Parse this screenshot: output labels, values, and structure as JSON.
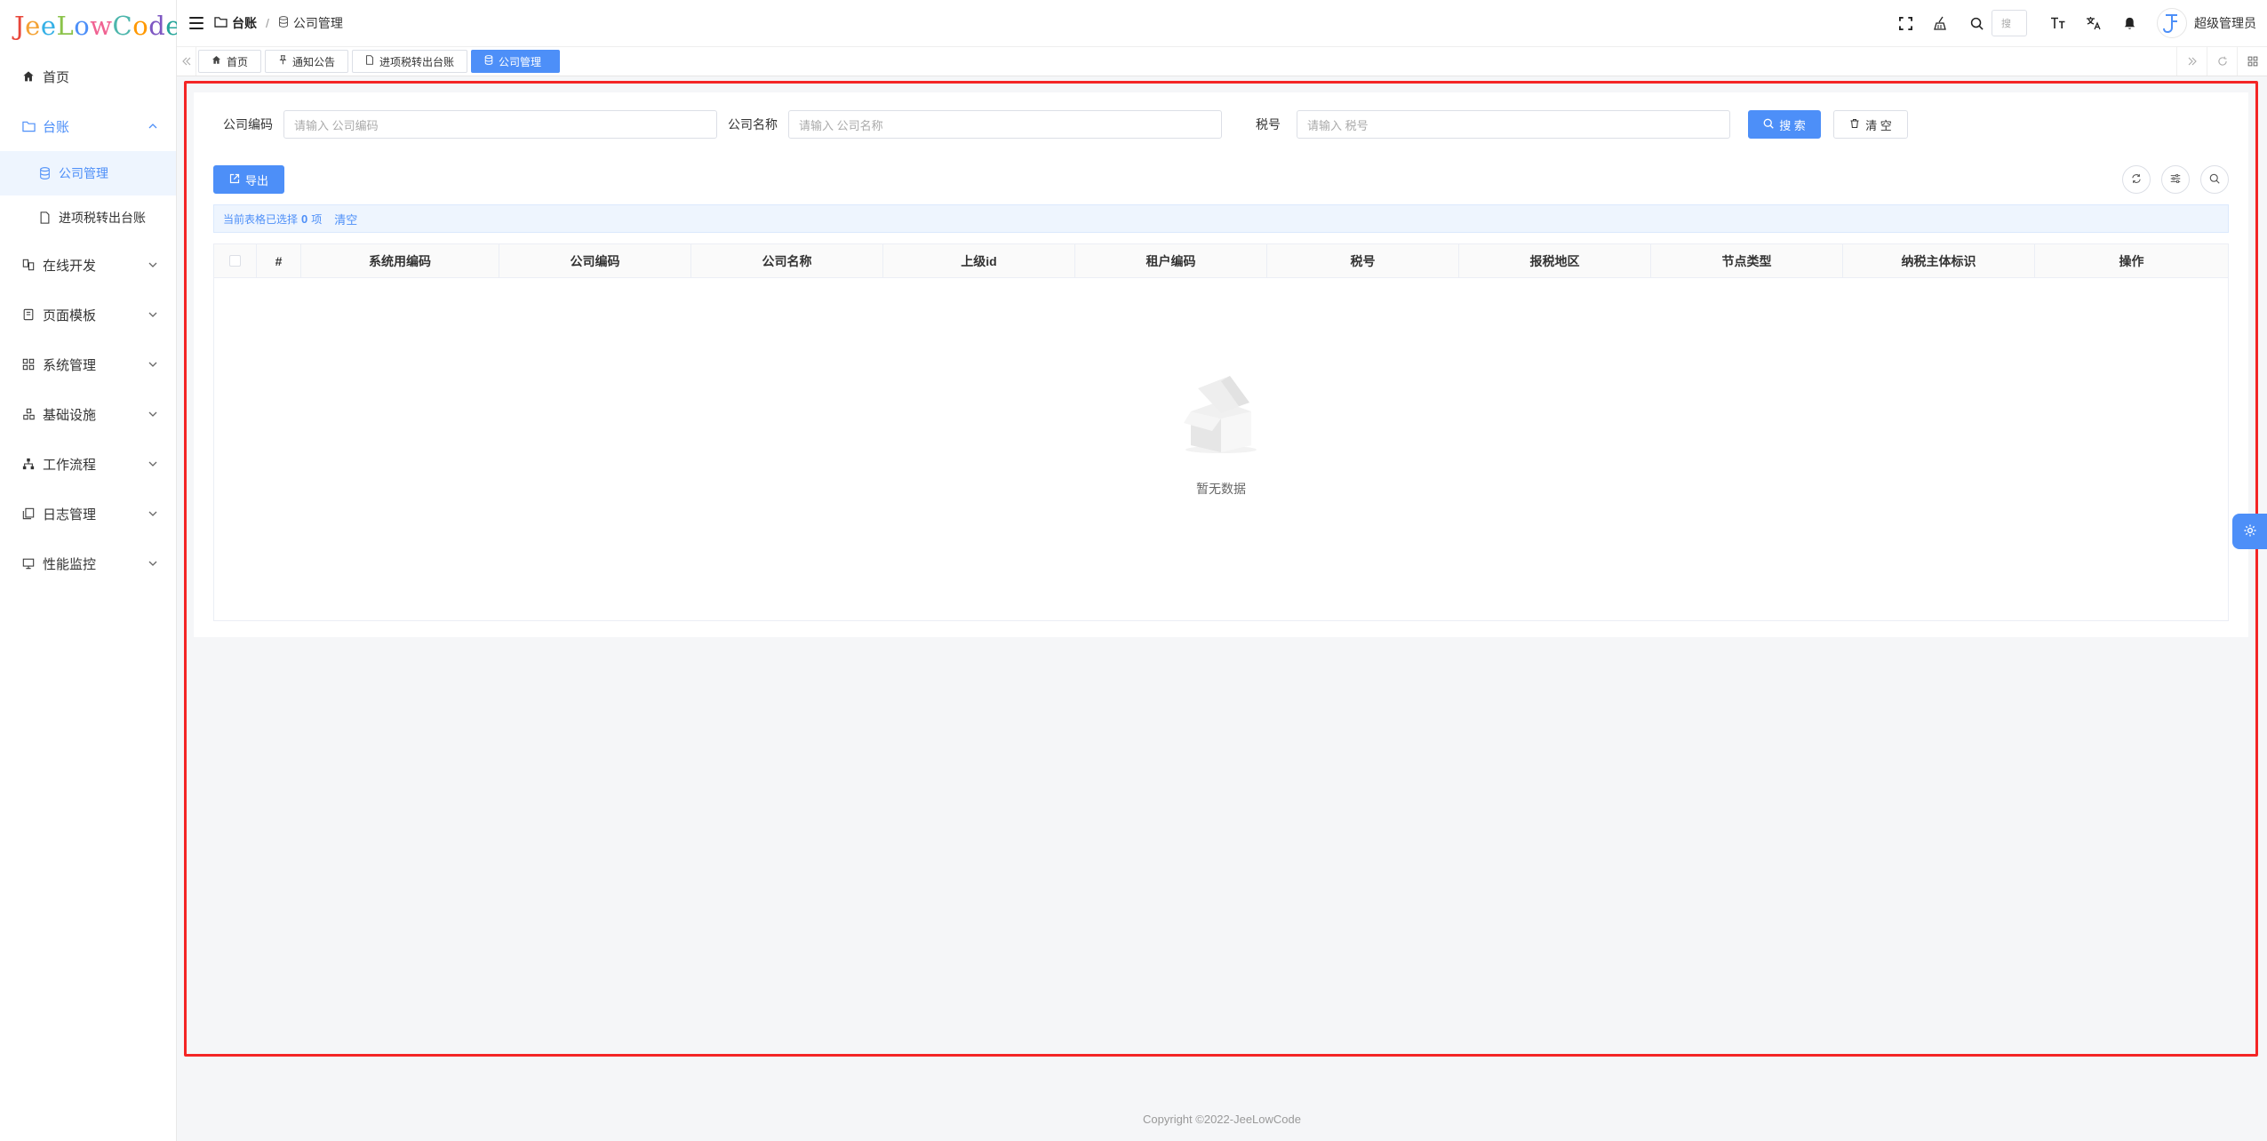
{
  "app": {
    "logo_text": "JeeLowCode",
    "logo_colors": [
      "#e8473b",
      "#f4a234",
      "#35b0e6",
      "#8bc34a",
      "#4d8ff8",
      "#f06292",
      "#4db6ac",
      "#ff9800",
      "#7e57c2",
      "#26a69a"
    ]
  },
  "sidebar": {
    "items": [
      {
        "label": "首页",
        "icon": "home-icon"
      },
      {
        "label": "台账",
        "icon": "folder-icon",
        "expanded": true
      },
      {
        "label": "在线开发",
        "icon": "dev-icon"
      },
      {
        "label": "页面模板",
        "icon": "template-icon"
      },
      {
        "label": "系统管理",
        "icon": "grid-icon"
      },
      {
        "label": "基础设施",
        "icon": "infra-icon"
      },
      {
        "label": "工作流程",
        "icon": "workflow-icon"
      },
      {
        "label": "日志管理",
        "icon": "log-icon"
      },
      {
        "label": "性能监控",
        "icon": "monitor-icon"
      }
    ],
    "submenu": [
      {
        "label": "公司管理",
        "active": true
      },
      {
        "label": "进项税转出台账",
        "active": false
      }
    ]
  },
  "header": {
    "breadcrumb": [
      "台账",
      "公司管理"
    ],
    "search_placeholder": "搜",
    "user_name": "超级管理员"
  },
  "tabs": [
    {
      "label": "首页",
      "icon": "home-icon"
    },
    {
      "label": "通知公告",
      "icon": "pin-icon"
    },
    {
      "label": "进项税转出台账",
      "icon": "doc-icon"
    },
    {
      "label": "公司管理",
      "icon": "db-icon",
      "active": true
    }
  ],
  "search": {
    "company_code_label": "公司编码",
    "company_code_placeholder": "请输入 公司编码",
    "company_name_label": "公司名称",
    "company_name_placeholder": "请输入 公司名称",
    "tax_no_label": "税号",
    "tax_no_placeholder": "请输入 税号",
    "search_button": "搜 索",
    "clear_button": "清 空"
  },
  "toolbar": {
    "export_button": "导出"
  },
  "selection": {
    "prefix": "当前表格已选择",
    "count": "0",
    "suffix": "项",
    "clear_link": "清空"
  },
  "table": {
    "columns": [
      "#",
      "系统用编码",
      "公司编码",
      "公司名称",
      "上级id",
      "租户编码",
      "税号",
      "报税地区",
      "节点类型",
      "纳税主体标识",
      "操作"
    ],
    "rows": [],
    "empty_text": "暂无数据"
  },
  "footer": {
    "copyright": "Copyright ©2022-JeeLowCode"
  },
  "colors": {
    "primary": "#4d8ff8",
    "highlight_frame": "#f42525"
  }
}
